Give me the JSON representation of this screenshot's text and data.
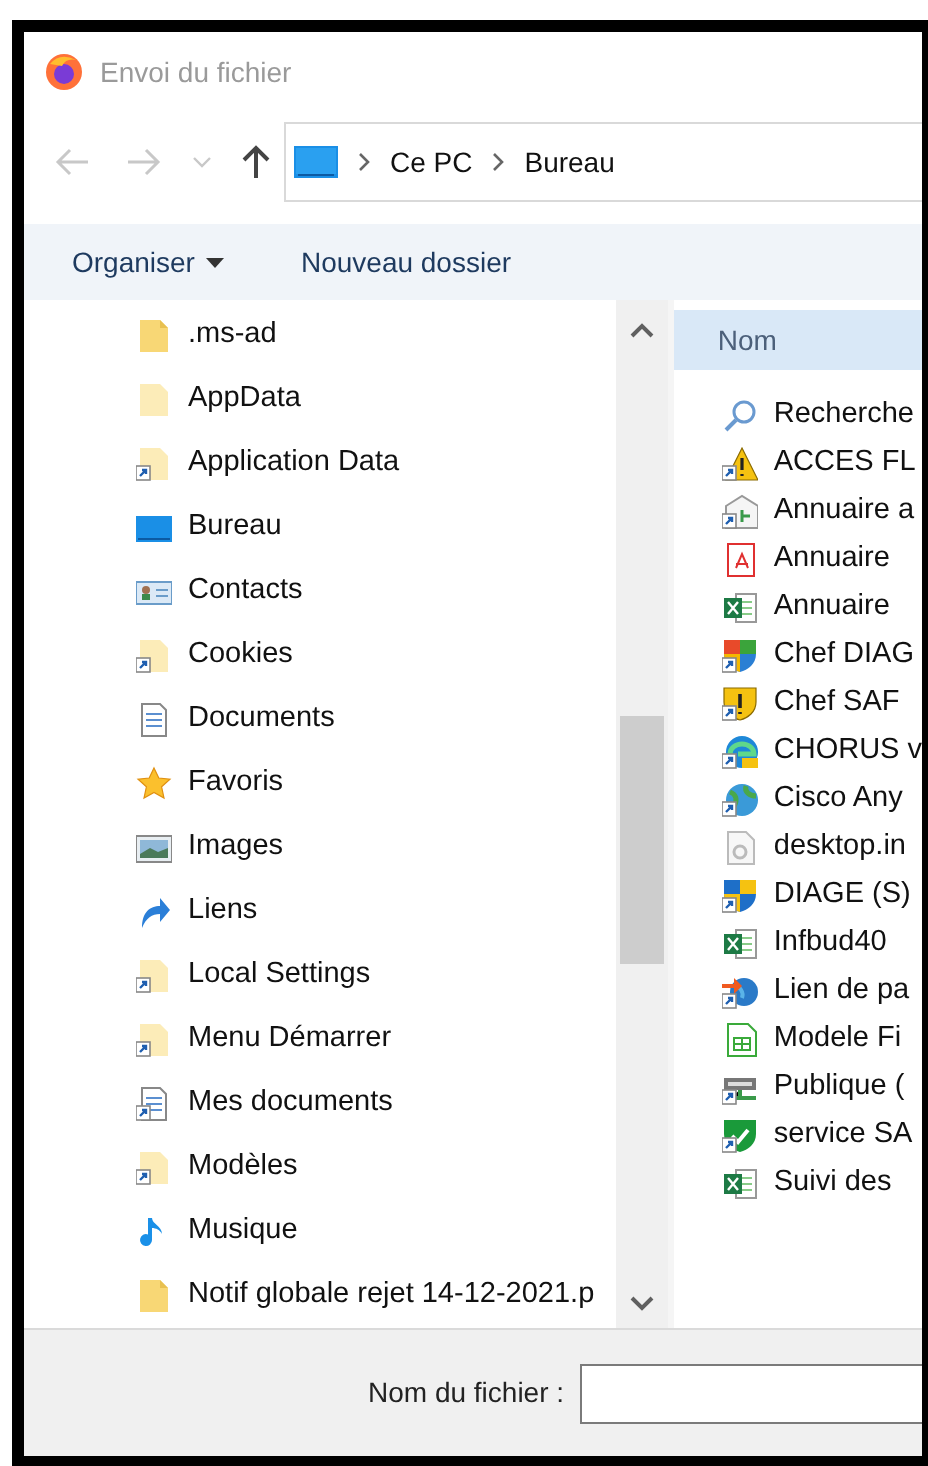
{
  "window": {
    "title": "Envoi du fichier"
  },
  "nav": {
    "back_disabled": true,
    "forward_disabled": true
  },
  "breadcrumb": [
    "Ce PC",
    "Bureau"
  ],
  "toolbar": {
    "organize": "Organiser",
    "new_folder": "Nouveau dossier"
  },
  "sidebar": {
    "items": [
      {
        "label": ".ms-ad",
        "kind": "folder",
        "shortcut": false
      },
      {
        "label": "AppData",
        "kind": "hidden",
        "shortcut": false
      },
      {
        "label": "Application Data",
        "kind": "hidden",
        "shortcut": true
      },
      {
        "label": "Bureau",
        "kind": "desktop",
        "shortcut": false
      },
      {
        "label": "Contacts",
        "kind": "contacts",
        "shortcut": false
      },
      {
        "label": "Cookies",
        "kind": "hidden",
        "shortcut": true
      },
      {
        "label": "Documents",
        "kind": "document",
        "shortcut": false
      },
      {
        "label": "Favoris",
        "kind": "star",
        "shortcut": false
      },
      {
        "label": "Images",
        "kind": "picture",
        "shortcut": false
      },
      {
        "label": "Liens",
        "kind": "link",
        "shortcut": false
      },
      {
        "label": "Local Settings",
        "kind": "hidden",
        "shortcut": true
      },
      {
        "label": "Menu Démarrer",
        "kind": "hidden",
        "shortcut": true
      },
      {
        "label": "Mes documents",
        "kind": "document",
        "shortcut": true
      },
      {
        "label": "Modèles",
        "kind": "hidden",
        "shortcut": true
      },
      {
        "label": "Musique",
        "kind": "music",
        "shortcut": false
      },
      {
        "label": "Notif globale rejet 14-12-2021.p",
        "kind": "folder",
        "shortcut": false
      }
    ]
  },
  "files": {
    "column": "Nom",
    "items": [
      {
        "label": "Recherche",
        "kind": "search",
        "shortcut": false
      },
      {
        "label": "ACCES FL",
        "kind": "warning",
        "shortcut": true
      },
      {
        "label": "Annuaire a",
        "kind": "network",
        "shortcut": true
      },
      {
        "label": "Annuaire",
        "kind": "pdf",
        "shortcut": false
      },
      {
        "label": "Annuaire",
        "kind": "excel",
        "shortcut": false
      },
      {
        "label": "Chef DIAG",
        "kind": "shield",
        "shortcut": true
      },
      {
        "label": "Chef SAF",
        "kind": "alert",
        "shortcut": true
      },
      {
        "label": "CHORUS v",
        "kind": "swirl",
        "shortcut": true
      },
      {
        "label": "Cisco Any",
        "kind": "globe",
        "shortcut": true
      },
      {
        "label": "desktop.in",
        "kind": "settings",
        "shortcut": false
      },
      {
        "label": "DIAGE (S)",
        "kind": "uac",
        "shortcut": true
      },
      {
        "label": "Infbud40",
        "kind": "excel",
        "shortcut": false
      },
      {
        "label": "Lien de pa",
        "kind": "web",
        "shortcut": true
      },
      {
        "label": "Modele Fi",
        "kind": "sheet",
        "shortcut": false
      },
      {
        "label": "Publique (",
        "kind": "drive",
        "shortcut": true
      },
      {
        "label": "service SA",
        "kind": "secure",
        "shortcut": true
      },
      {
        "label": "Suivi des",
        "kind": "excel",
        "shortcut": false
      }
    ]
  },
  "filename": {
    "label": "Nom du fichier :"
  }
}
